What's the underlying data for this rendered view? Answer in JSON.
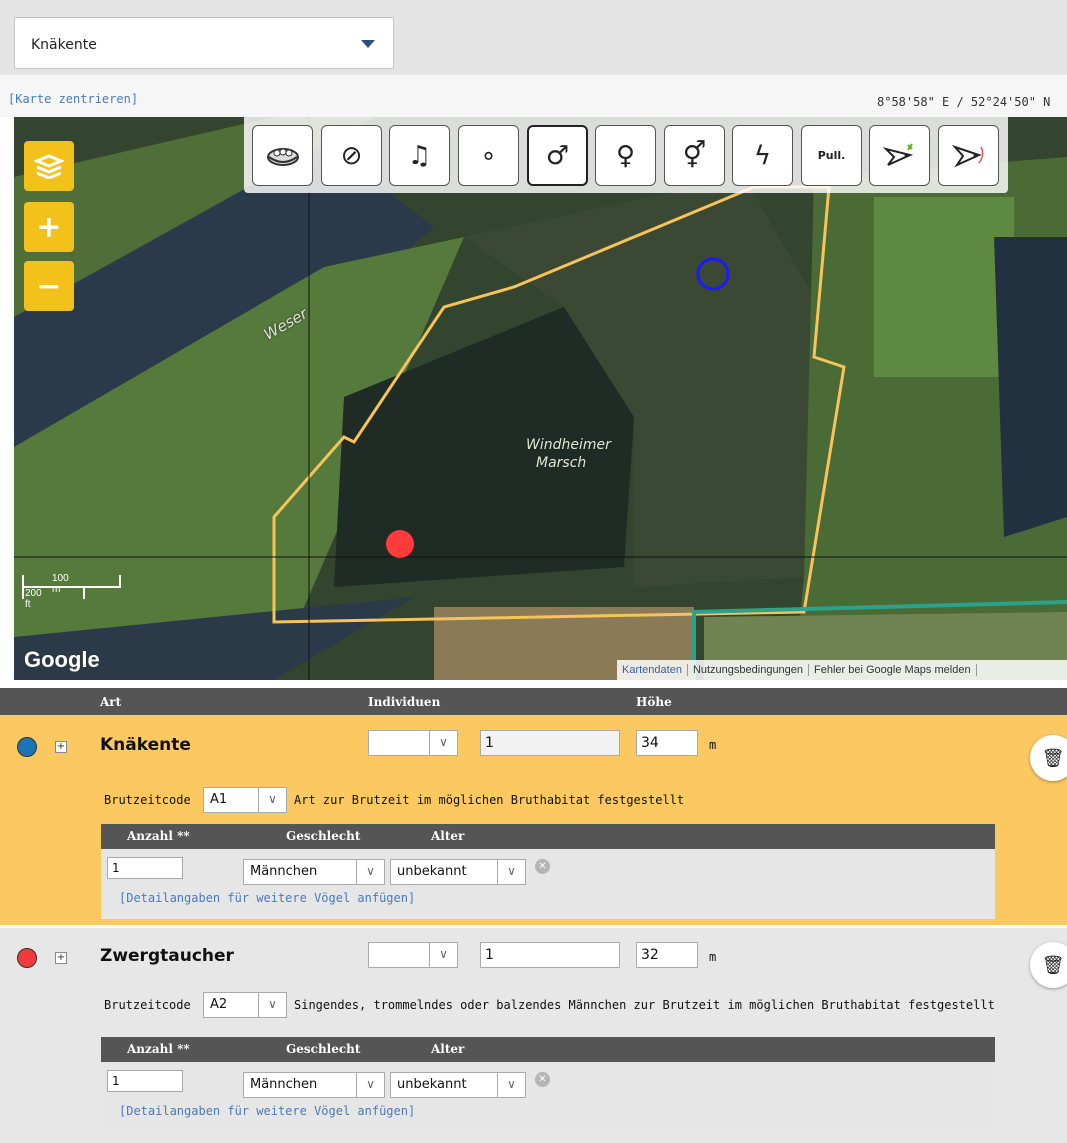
{
  "species_select": {
    "value": "Knäkente"
  },
  "map_header": {
    "center_link": "[Karte zentrieren]",
    "coordinates": "8°58'58\" E / 52°24'50\" N"
  },
  "map": {
    "labels": {
      "river": "Weser",
      "place_line1": "Windheimer",
      "place_line2": "Marsch"
    },
    "scale": {
      "meters": "100 m",
      "feet": "200 ft"
    },
    "google_logo": "Google",
    "footer": [
      "Kartendaten",
      "Nutzungsbedingungen",
      "Fehler bei Google Maps melden"
    ],
    "controls": [
      {
        "name": "layers-icon"
      },
      {
        "name": "zoom-in-icon",
        "glyph": "+"
      },
      {
        "name": "zoom-out-icon",
        "glyph": "−"
      }
    ],
    "markers": [
      {
        "species": "Knäkente",
        "color": "#1a1aff",
        "style": "ring"
      },
      {
        "species": "Zwergtaucher",
        "color": "#ff3b3b",
        "style": "filled"
      }
    ]
  },
  "observation_toolbar": [
    {
      "name": "nest-icon",
      "glyph": ""
    },
    {
      "name": "none-icon",
      "glyph": "⊘"
    },
    {
      "name": "song-icon",
      "glyph": "♫"
    },
    {
      "name": "unspecified-icon",
      "glyph": "∘"
    },
    {
      "name": "male-icon",
      "glyph": "♂",
      "selected": true
    },
    {
      "name": "female-icon",
      "glyph": "♀"
    },
    {
      "name": "pair-icon",
      "glyph": "⚥"
    },
    {
      "name": "warning-icon",
      "glyph": "ϟ"
    },
    {
      "name": "pullus-button",
      "glyph": "Pull."
    },
    {
      "name": "flying-food-icon",
      "glyph": ""
    },
    {
      "name": "flying-icon",
      "glyph": ""
    }
  ],
  "table": {
    "headers": {
      "art": "Art",
      "individuen": "Individuen",
      "hoehe": "Höhe"
    },
    "sub_headers": {
      "anzahl": "Anzahl **",
      "geschlecht": "Geschlecht",
      "alter": "Alter"
    },
    "brutzeitcode_label": "Brutzeitcode",
    "unit": "m",
    "detail_link": "[Detailangaben für weitere Vögel anfügen]",
    "rows": [
      {
        "color": "#1d73b8",
        "name": "Knäkente",
        "individuen": "1",
        "hoehe": "34",
        "brutzeitcode": "A1",
        "brutzeit_desc": "Art zur Brutzeit im möglichen Bruthabitat festgestellt",
        "detail": {
          "anzahl": "1",
          "geschlecht": "Männchen",
          "alter": "unbekannt"
        }
      },
      {
        "color": "#ef3b3b",
        "name": "Zwergtaucher",
        "individuen": "1",
        "hoehe": "32",
        "brutzeitcode": "A2",
        "brutzeit_desc": "Singendes, trommelndes oder balzendes Männchen zur Brutzeit im möglichen Bruthabitat festgestellt",
        "detail": {
          "anzahl": "1",
          "geschlecht": "Männchen",
          "alter": "unbekannt"
        }
      }
    ]
  }
}
